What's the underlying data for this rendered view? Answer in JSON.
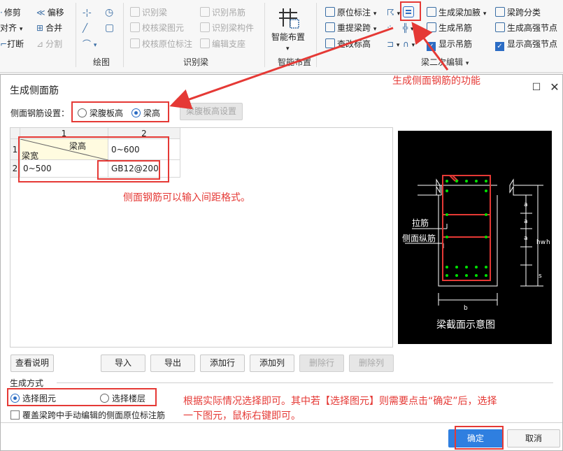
{
  "ribbon": {
    "edit": {
      "trim": "修剪",
      "offset": "偏移",
      "align": "对齐",
      "merge": "合并",
      "break": "打断",
      "split": "分割"
    },
    "draw_label": "绘图",
    "recognize": {
      "recognize_beam": "识别梁",
      "recognize_hanger": "识别吊筋",
      "check_beam_element": "校核梁图元",
      "recognize_beam_component": "识别梁构件",
      "check_in_situ_annotation": "校核原位标注",
      "edit_support": "编辑支座"
    },
    "recognize_label": "识别梁",
    "smart_layout": "智能布置",
    "smart_layout_group": "智能布置",
    "beam_edit": {
      "in_situ_annotation": "原位标注",
      "re_extract_span": "重提梁跨",
      "modify_elevation": "查改标高",
      "gen_haunch": "生成梁加腋",
      "gen_hanger": "生成吊筋",
      "show_hanger": "显示吊筋",
      "span_classify": "梁跨分类",
      "gen_high_strength_joint": "生成高强节点",
      "show_high_strength_joint": "显示高强节点"
    },
    "beam_secondary_edit_label": "梁二次编辑"
  },
  "annotations": {
    "function_note": "生成侧面钢筋的功能",
    "spacing_note": "侧面钢筋可以输入间距格式。",
    "select_note_line1": "根据实际情况选择即可。其中若【选择图元】则需要点击“确定”后，选择",
    "select_note_line2": "一下图元，鼠标右键即可。"
  },
  "dialog": {
    "title": "生成侧面筋",
    "side_rebar_setting_label": "侧面钢筋设置：",
    "option_web_height": "梁腹板高",
    "option_beam_height": "梁高",
    "web_height_settings_btn": "梁腹板高设置",
    "grid": {
      "col_headers": [
        "1",
        "2"
      ],
      "row_headers": [
        "1",
        "2"
      ],
      "corner_top": "梁高",
      "corner_bottom": "梁宽",
      "rows": [
        [
          "",
          "0~600"
        ],
        [
          "0~500",
          "GB12@200"
        ]
      ]
    },
    "buttons": {
      "view_help": "查看说明",
      "import": "导入",
      "export": "导出",
      "add_row": "添加行",
      "add_col": "添加列",
      "delete_row": "删除行",
      "delete_col": "删除列"
    },
    "gen_method_label": "生成方式",
    "select_element": "选择图元",
    "select_floor": "选择楼层",
    "overwrite_checkbox": "覆盖梁跨中手动编辑的侧面原位标注筋",
    "ok": "确定",
    "cancel": "取消",
    "diagram": {
      "tie_bar": "拉筋",
      "side_longitudinal": "侧面纵筋",
      "caption": "梁截面示意图",
      "dim_a": "a",
      "dim_hw": "hw",
      "dim_h": "h",
      "dim_s": "s",
      "dim_b": "b"
    }
  },
  "colors": {
    "annotation_red": "#e53935",
    "accent_blue": "#2b6cc4",
    "rebar_green": "#00e000"
  }
}
